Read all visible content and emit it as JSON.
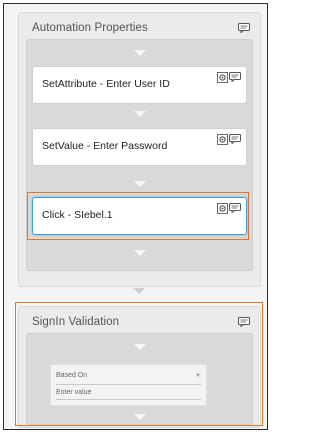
{
  "automation_panel": {
    "title": "Automation Properties",
    "steps": [
      {
        "label": "SetAttribute - Enter User ID",
        "selected": false
      },
      {
        "label": "SetValue - Enter Password",
        "selected": false
      },
      {
        "label": "Click - SIebel.1",
        "selected": true
      }
    ]
  },
  "signin_panel": {
    "title": "SignIn Validation",
    "based_on_label": "Based On",
    "value_placeholder": "Enter value"
  },
  "colors": {
    "highlight_orange": "#e1762b",
    "selected_blue": "#3aa0dc"
  }
}
